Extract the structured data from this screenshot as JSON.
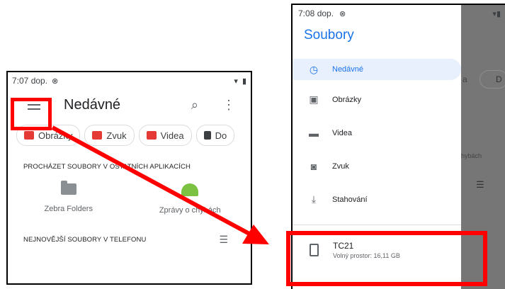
{
  "left_screen": {
    "status": {
      "time": "7:07 dop.",
      "symbol": "⊗"
    },
    "topbar": {
      "title": "Nedávné",
      "search_glyph": "⌕",
      "more_glyph": "⋮"
    },
    "chips": [
      {
        "label": "Obrázky",
        "icon": "image-icon",
        "color": "#e53935"
      },
      {
        "label": "Zvuk",
        "icon": "audio-icon",
        "color": "#e53935"
      },
      {
        "label": "Videa",
        "icon": "video-icon",
        "color": "#e53935"
      },
      {
        "label": "Do",
        "icon": "document-icon",
        "color": "#3c4043"
      }
    ],
    "browse_header": "PROCHÁZET SOUBORY V OSTATNÍCH APLIKACÍCH",
    "apps": [
      {
        "label": "Zebra Folders",
        "icon": "folder-icon"
      },
      {
        "label": "Zprávy o chybách",
        "icon": "android-icon"
      }
    ],
    "recent_header": "NEJNOVĚJŠÍ SOUBORY V TELEFONU"
  },
  "right_screen": {
    "status": {
      "time": "7:08 dop.",
      "symbol": "⊗"
    },
    "drawer_title": "Soubory",
    "items": [
      {
        "label": "Nedávné",
        "icon": "clock-icon",
        "active": true
      },
      {
        "label": "Obrázky",
        "icon": "image-icon"
      },
      {
        "label": "Videa",
        "icon": "video-icon"
      },
      {
        "label": "Zvuk",
        "icon": "audio-icon"
      },
      {
        "label": "Stahování",
        "icon": "download-icon"
      }
    ],
    "storage": {
      "name": "TC21",
      "free": "Volný prostor: 16,11 GB"
    },
    "background": {
      "chip_fragment": "D",
      "text_fragment": "hybách",
      "letter": "a"
    }
  },
  "colors": {
    "highlight": "#ff0000",
    "accent": "#1a73e8"
  }
}
